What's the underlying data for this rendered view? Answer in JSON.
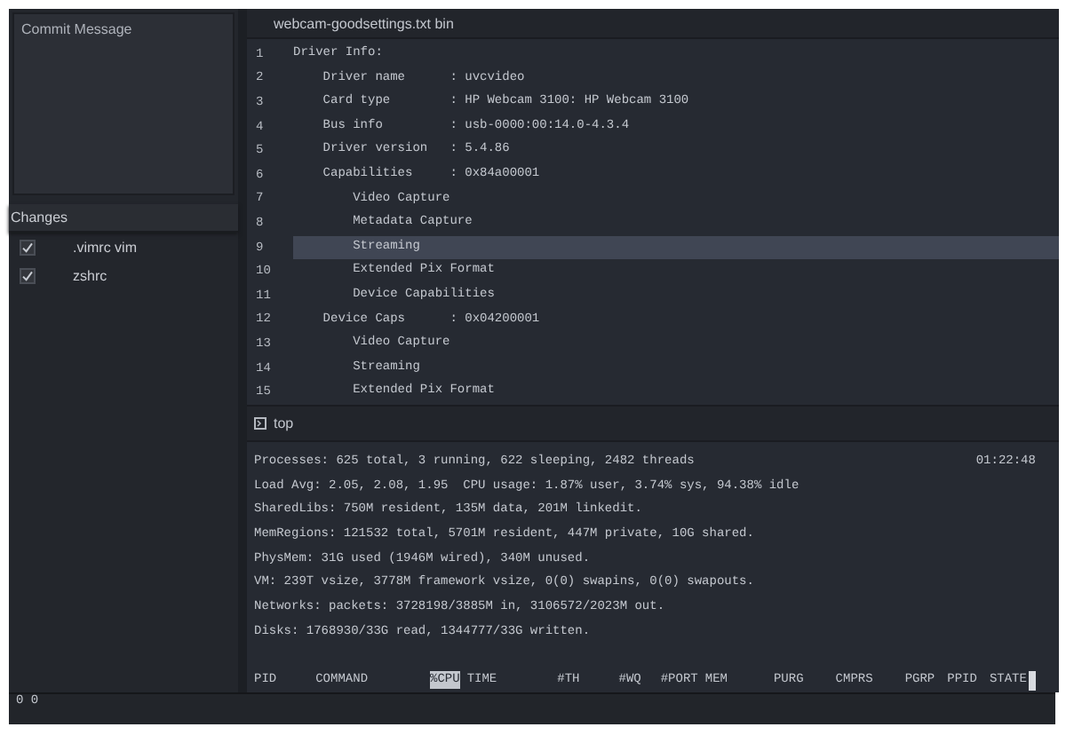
{
  "sidebar": {
    "commit_message": {
      "placeholder": "Commit Message"
    },
    "changes_title": "Changes",
    "changes": [
      {
        "name": ".vimrc vim",
        "checked": true
      },
      {
        "name": "zshrc",
        "checked": true
      }
    ]
  },
  "editor": {
    "tab": "webcam-goodsettings.txt bin",
    "lines": [
      {
        "number": "1",
        "text": "Driver Info:",
        "selected": false
      },
      {
        "number": "2",
        "text": "    Driver name      : uvcvideo",
        "selected": false
      },
      {
        "number": "3",
        "text": "    Card type        : HP Webcam 3100: HP Webcam 3100",
        "selected": false
      },
      {
        "number": "4",
        "text": "    Bus info         : usb-0000:00:14.0-4.3.4",
        "selected": false
      },
      {
        "number": "5",
        "text": "    Driver version   : 5.4.86",
        "selected": false
      },
      {
        "number": "6",
        "text": "    Capabilities     : 0x84a00001",
        "selected": false
      },
      {
        "number": "7",
        "text": "        Video Capture",
        "selected": false
      },
      {
        "number": "8",
        "text": "        Metadata Capture",
        "selected": false
      },
      {
        "number": "9",
        "text": "        Streaming",
        "selected": true
      },
      {
        "number": "10",
        "text": "        Extended Pix Format",
        "selected": false
      },
      {
        "number": "11",
        "text": "        Device Capabilities",
        "selected": false
      },
      {
        "number": "12",
        "text": "    Device Caps      : 0x04200001",
        "selected": false
      },
      {
        "number": "13",
        "text": "        Video Capture",
        "selected": false
      },
      {
        "number": "14",
        "text": "        Streaming",
        "selected": false
      },
      {
        "number": "15",
        "text": "        Extended Pix Format",
        "selected": false
      }
    ]
  },
  "terminal": {
    "title": "top",
    "clock": "01:22:48",
    "lines": [
      "Processes: 625 total, 3 running, 622 sleeping, 2482 threads",
      "Load Avg: 2.05, 2.08, 1.95  CPU usage: 1.87% user, 3.74% sys, 94.38% idle",
      "SharedLibs: 750M resident, 135M data, 201M linkedit.",
      "MemRegions: 121532 total, 5701M resident, 447M private, 10G shared.",
      "PhysMem: 31G used (1946M wired), 340M unused.",
      "VM: 239T vsize, 3778M framework vsize, 0(0) swapins, 0(0) swapouts.",
      "Networks: packets: 3728198/3885M in, 3106572/2023M out.",
      "Disks: 1768930/33G read, 1344777/33G written."
    ],
    "columns": [
      {
        "label": "PID",
        "selected": false
      },
      {
        "label": "COMMAND",
        "selected": false
      },
      {
        "label": "%CPU",
        "selected": true
      },
      {
        "label": "TIME",
        "selected": false
      },
      {
        "label": "#TH",
        "selected": false
      },
      {
        "label": "#WQ",
        "selected": false
      },
      {
        "label": "#PORT",
        "selected": false
      },
      {
        "label": "MEM",
        "selected": false
      },
      {
        "label": "PURG",
        "selected": false
      },
      {
        "label": "CMPRS",
        "selected": false
      },
      {
        "label": "PGRP",
        "selected": false
      },
      {
        "label": "PPID",
        "selected": false
      },
      {
        "label": "STATE",
        "selected": false
      }
    ]
  },
  "status_bar": "0 0"
}
